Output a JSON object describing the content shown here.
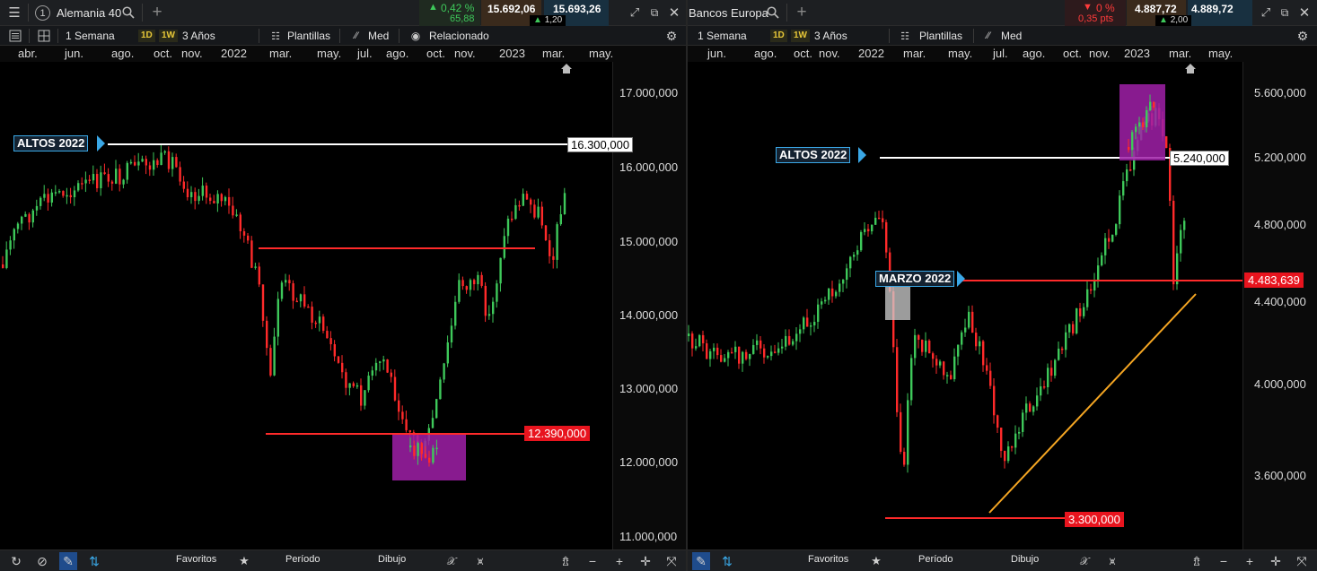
{
  "left": {
    "instrument": "Alemania 40",
    "slot_number": "1",
    "change_pct": "0,42 %",
    "change_pts": "65,88",
    "sell_price": "15.692,06",
    "buy_price": "15.693,26",
    "spread": "1,20",
    "timeframe": "1 Semana",
    "interval_1d": "1D",
    "interval_1w": "1W",
    "range": "3 Años",
    "templates": "Plantillas",
    "indicator": "Med",
    "related": "Relacionado",
    "months": [
      "abr.",
      "jun.",
      "ago.",
      "oct.",
      "nov.",
      "2022",
      "mar.",
      "may.",
      "jul.",
      "ago.",
      "oct.",
      "nov.",
      "2023",
      "mar.",
      "may."
    ],
    "y_ticks": [
      "17.000,000",
      "16.000,000",
      "15.000,000",
      "14.000,000",
      "13.000,000",
      "12.000,000",
      "11.000,000"
    ],
    "tag_label": "ALTOS 2022",
    "high_line_value": "16.300,000",
    "low_line_value": "12.390,000",
    "bottom": {
      "favorites": "Favoritos",
      "period": "Período",
      "drawing": "Dibujo"
    }
  },
  "right": {
    "instrument": "Bancos Europa",
    "change_pct": "0 %",
    "change_pts": "0,35 pts",
    "sell_price": "4.887,72",
    "buy_price": "4.889,72",
    "spread": "2,00",
    "timeframe": "1 Semana",
    "interval_1d": "1D",
    "interval_1w": "1W",
    "range": "3 Años",
    "templates": "Plantillas",
    "indicator": "Med",
    "months": [
      "jun.",
      "ago.",
      "oct.",
      "nov.",
      "2022",
      "mar.",
      "may.",
      "jul.",
      "ago.",
      "oct.",
      "nov.",
      "2023",
      "mar.",
      "may."
    ],
    "y_ticks": [
      "5.600,000",
      "5.200,000",
      "4.800,000",
      "4.400,000",
      "4.000,000",
      "3.600,000"
    ],
    "tag_high": "ALTOS 2022",
    "tag_march": "MARZO 2022",
    "high_line_value": "5.240,000",
    "march_line_value": "4.483,639",
    "low_line_value": "3.300,000",
    "bottom": {
      "favorites": "Favoritos",
      "period": "Período",
      "drawing": "Dibujo"
    }
  },
  "colors": {
    "up": "#3ec85a",
    "down": "#ff2a2a",
    "magenta": "#a020a8",
    "accent": "#3aa7e6",
    "trend": "#f5a623"
  }
}
